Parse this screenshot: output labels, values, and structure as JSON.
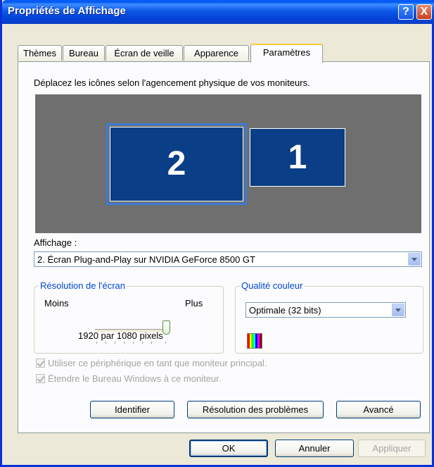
{
  "window": {
    "title": "Propriétés de Affichage",
    "help_label": "?",
    "close_label": "X"
  },
  "tabs": [
    {
      "label": "Thèmes"
    },
    {
      "label": "Bureau"
    },
    {
      "label": "Écran de veille"
    },
    {
      "label": "Apparence"
    },
    {
      "label": "Paramètres",
      "active": true
    }
  ],
  "settings": {
    "instruction": "Déplacez les icônes selon l'agencement physique de vos moniteurs.",
    "monitors": [
      {
        "number": "2",
        "selected": true
      },
      {
        "number": "1",
        "selected": false
      }
    ],
    "display_label": "Affichage :",
    "display_value": "2. Écran Plug-and-Play sur NVIDIA GeForce 8500 GT",
    "resolution": {
      "legend": "Résolution de l'écran",
      "less": "Moins",
      "more": "Plus",
      "value_text": "1920 par 1080 pixels",
      "slider_level": 1.0
    },
    "color_quality": {
      "legend": "Qualité couleur",
      "value": "Optimale (32 bits)"
    },
    "checkbox_primary": "Utiliser ce périphérique en tant que moniteur principal.",
    "checkbox_extend": "Étendre le Bureau Windows à ce moniteur.",
    "buttons": {
      "identify": "Identifier",
      "troubleshoot": "Résolution des problèmes",
      "advanced": "Avancé"
    }
  },
  "footer": {
    "ok": "OK",
    "cancel": "Annuler",
    "apply": "Appliquer"
  },
  "colors": {
    "title_bar": "#0058EE",
    "monitor": "#0A3E86",
    "legend_text": "#0046D5"
  }
}
